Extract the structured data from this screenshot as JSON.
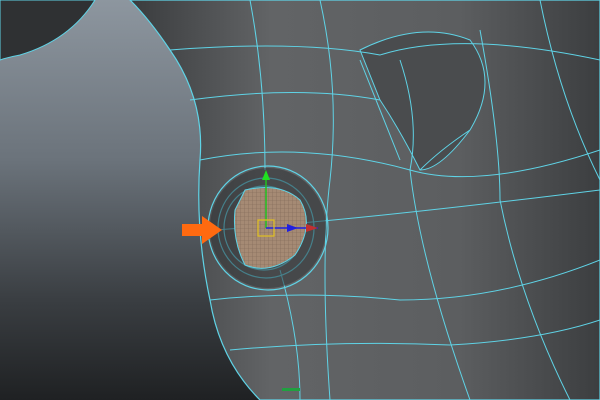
{
  "viewport": {
    "mode": "3d-wireframe-on-shaded",
    "colors": {
      "wireframe": "#5fd3e6",
      "mesh": "#5a5c5e",
      "selection_face": "#a58a74",
      "arrow": "#ff6a10",
      "axis_x": "#c03030",
      "axis_y": "#20c020",
      "axis_z": "#2020e0",
      "pivot": "#e0c020"
    }
  }
}
